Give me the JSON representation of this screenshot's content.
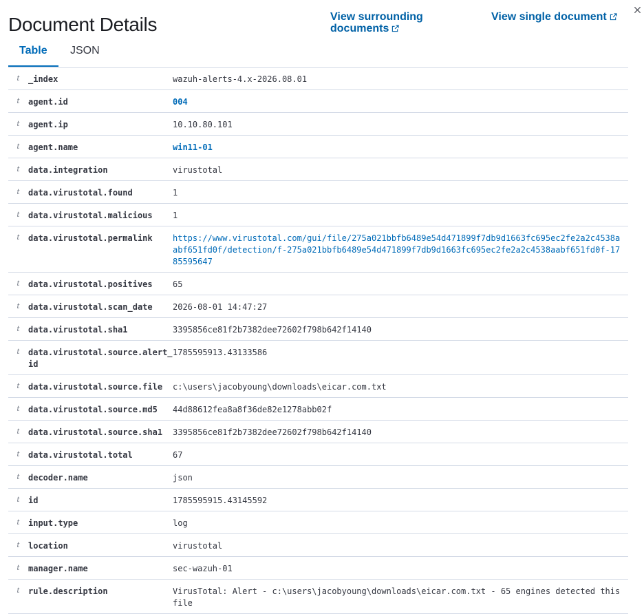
{
  "header": {
    "title": "Document Details",
    "view_surrounding": "View surrounding",
    "view_surrounding_2": "documents",
    "view_single": "View single document"
  },
  "tabs": [
    {
      "label": "Table",
      "active": true
    },
    {
      "label": "JSON",
      "active": false
    }
  ],
  "field_type_symbol": "t",
  "rows": [
    {
      "field": "_index",
      "value": "wazuh-alerts-4.x-2026.08.01"
    },
    {
      "field": "agent.id",
      "value": "004",
      "style": "link"
    },
    {
      "field": "agent.ip",
      "value": "10.10.80.101"
    },
    {
      "field": "agent.name",
      "value": "win11-01",
      "style": "link"
    },
    {
      "field": "data.integration",
      "value": "virustotal"
    },
    {
      "field": "data.virustotal.found",
      "value": "1"
    },
    {
      "field": "data.virustotal.malicious",
      "value": "1"
    },
    {
      "field": "data.virustotal.permalink",
      "value": "https://www.virustotal.com/gui/file/275a021bbfb6489e54d471899f7db9d1663fc695ec2fe2a2c4538aabf651fd0f/detection/f-275a021bbfb6489e54d471899f7db9d1663fc695ec2fe2a2c4538aabf651fd0f-1785595647",
      "style": "url"
    },
    {
      "field": "data.virustotal.positives",
      "value": "65"
    },
    {
      "field": "data.virustotal.scan_date",
      "value": "2026-08-01 14:47:27"
    },
    {
      "field": "data.virustotal.sha1",
      "value": "3395856ce81f2b7382dee72602f798b642f14140"
    },
    {
      "field": "data.virustotal.source.alert_id",
      "value": "1785595913.43133586"
    },
    {
      "field": "data.virustotal.source.file",
      "value": "c:\\users\\jacobyoung\\downloads\\eicar.com.txt"
    },
    {
      "field": "data.virustotal.source.md5",
      "value": "44d88612fea8a8f36de82e1278abb02f"
    },
    {
      "field": "data.virustotal.source.sha1",
      "value": "3395856ce81f2b7382dee72602f798b642f14140"
    },
    {
      "field": "data.virustotal.total",
      "value": "67"
    },
    {
      "field": "decoder.name",
      "value": "json"
    },
    {
      "field": "id",
      "value": "1785595915.43145592"
    },
    {
      "field": "input.type",
      "value": "log"
    },
    {
      "field": "location",
      "value": "virustotal"
    },
    {
      "field": "manager.name",
      "value": "sec-wazuh-01"
    },
    {
      "field": "rule.description",
      "value": "VirusTotal: Alert - c:\\users\\jacobyoung\\downloads\\eicar.com.txt - 65 engines detected this file"
    }
  ]
}
